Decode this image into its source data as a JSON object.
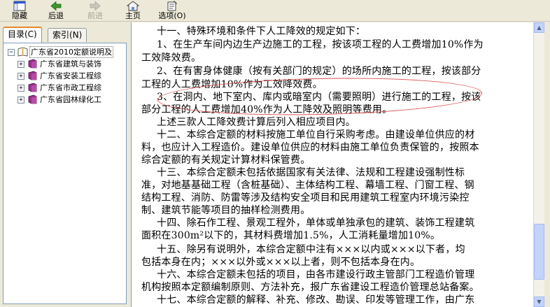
{
  "toolbar": {
    "hide": "隐藏",
    "back": "后退",
    "forward": "前进",
    "home": "主页",
    "options": "选项(O)"
  },
  "tabs": {
    "contents": "目录(C)",
    "index": "索引(N)"
  },
  "tree": {
    "root": "广东省2010定额说明及",
    "items": [
      "广东省建筑与装饰",
      "广东省安装工程综",
      "广东省市政工程综",
      "广东省园林绿化工"
    ]
  },
  "content": {
    "lines": [
      "十一、特殊环境和条件下人工降效的规定如下：",
      "1、在生产车间内边生产边施工的工程，按该项工程的人工费增加10%作为",
      "工效降效费。",
      "2、在有害身体健康（按有关部门的规定）的场所内施工的工程，按该部分",
      "工程的人工费增加10%作为工效降效费。",
      "3、在洞内、地下室内、库内或暗室内（需要照明）进行施工的工程，按该",
      "部分工程的人工费增加40%作为人工降效及照明等费用。",
      "上述三款人工降效费计算后列入相应项目内。",
      "十二、本综合定额的材料按施工单位自行采购考虑。由建设单位供应的材",
      "料，也应计入工程造价。建设单位供应的材料由施工单位负责保管的，按照本",
      "综合定额的有关规定计算材料保管费。",
      "十三、本综合定额未包括依据国家有关法律、法规和工程建设强制性标",
      "准，对地基基础工程（含桩基础）、主体结构工程、幕墙工程、门窗工程、钢",
      "结构工程、消防、防雷等涉及结构安全项目和民用建筑工程室内环境污染控",
      "制、建筑节能等项目的抽样检测费用。",
      "十四、除石作工程、景观工程外，单体或单独承包的建筑、装饰工程建筑",
      "面积在300m²以下的，其材料费增加1.5%，人工消耗量增加10%。",
      "十五、除另有说明外，本综合定额中注有×××以内或×××以下者，均",
      "包括本身在内；×××以外或×××以上者，则不包括本身在内。",
      "十六、本综合定额未包括的项目，由各市建设行政主管部门工程造价管理",
      "机构按照本定额编制原则、方法补充，报广东省建设工程造价管理总站备案。",
      "十七、本综合定额的解释、补充、修改、勘误、印发等管理工作，由广东"
    ]
  },
  "colors": {
    "highlight_ellipse": "#d85050",
    "book_icon": "#9b2f8e",
    "tab_accent": "#e68b2c"
  },
  "icons": {
    "hide": "hide-pane-icon",
    "back": "back-arrow-icon",
    "forward": "forward-arrow-icon",
    "home": "home-icon",
    "options": "options-icon",
    "book": "book-icon"
  }
}
